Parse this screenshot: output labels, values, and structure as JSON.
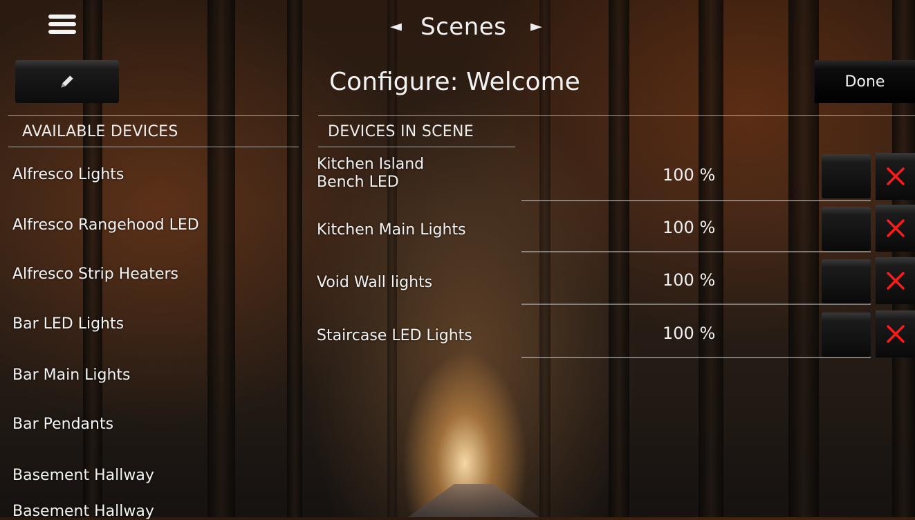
{
  "header": {
    "title": "Scenes",
    "prev_arrow": "◄",
    "next_arrow": "►"
  },
  "toolbar": {
    "configure_title": "Configure: Welcome",
    "done_label": "Done"
  },
  "available": {
    "header": "AVAILABLE DEVICES",
    "items": [
      "Alfresco Lights",
      "Alfresco Rangehood LED",
      "Alfresco Strip Heaters",
      "Bar LED Lights",
      "Bar Main Lights",
      "Bar Pendants",
      "Basement Hallway",
      "Basement Hallway"
    ]
  },
  "scene": {
    "header": "DEVICES IN SCENE",
    "devices": [
      {
        "name_line1": "Kitchen Island",
        "name_line2": "Bench LED",
        "level": "100 %"
      },
      {
        "name_line1": "Kitchen Main Lights",
        "name_line2": "",
        "level": "100 %"
      },
      {
        "name_line1": "Void Wall lights",
        "name_line2": "",
        "level": "100 %"
      },
      {
        "name_line1": "Staircase LED Lights",
        "name_line2": "",
        "level": "100 %"
      }
    ]
  },
  "icons": {
    "menu": "hamburger-icon",
    "edit": "pencil-icon",
    "remove": "close-icon"
  },
  "colors": {
    "remove_x": "#ff1a1a",
    "button_bg": "#0c0c0c"
  }
}
